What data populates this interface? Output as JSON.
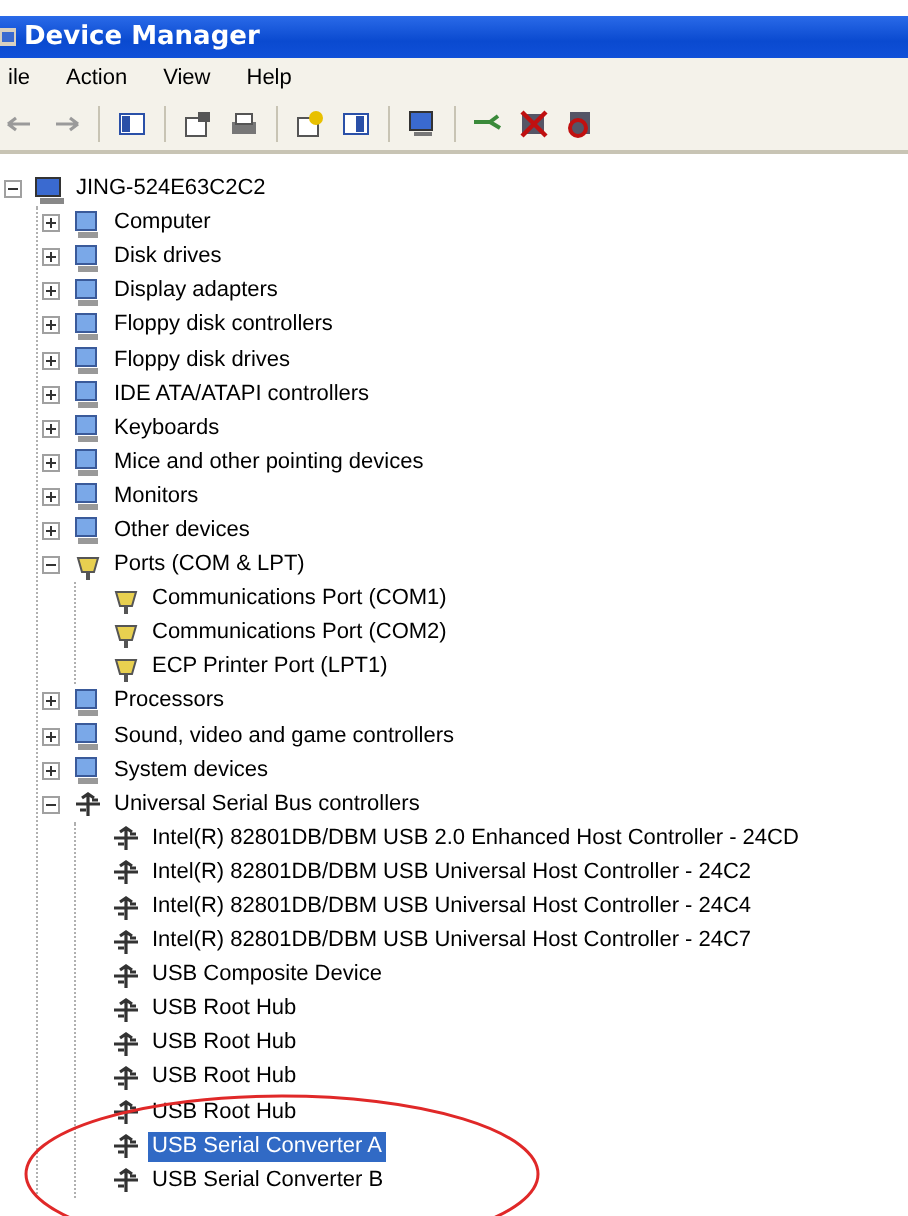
{
  "window": {
    "title": "Device Manager"
  },
  "menu": [
    {
      "label": "ile"
    },
    {
      "label": "Action"
    },
    {
      "label": "View"
    },
    {
      "label": "Help"
    }
  ],
  "tree": {
    "label": "JING-524E63C2C2",
    "kind": "computer",
    "expanded": true,
    "selected": false,
    "children": [
      {
        "label": "Computer",
        "kind": "device",
        "expanded": false,
        "selected": false
      },
      {
        "label": "Disk drives",
        "kind": "device",
        "expanded": false,
        "selected": false
      },
      {
        "label": "Display adapters",
        "kind": "device",
        "expanded": false,
        "selected": false
      },
      {
        "label": "Floppy disk controllers",
        "kind": "device",
        "expanded": false,
        "selected": false
      },
      {
        "label": "Floppy disk drives",
        "kind": "device",
        "expanded": false,
        "selected": false
      },
      {
        "label": "IDE ATA/ATAPI controllers",
        "kind": "device",
        "expanded": false,
        "selected": false
      },
      {
        "label": "Keyboards",
        "kind": "device",
        "expanded": false,
        "selected": false
      },
      {
        "label": "Mice and other pointing devices",
        "kind": "device",
        "expanded": false,
        "selected": false
      },
      {
        "label": "Monitors",
        "kind": "device",
        "expanded": false,
        "selected": false
      },
      {
        "label": "Other devices",
        "kind": "device",
        "expanded": false,
        "selected": false
      },
      {
        "label": "Ports (COM & LPT)",
        "kind": "port",
        "expanded": true,
        "selected": false,
        "children": [
          {
            "label": "Communications Port (COM1)",
            "kind": "port",
            "selected": false
          },
          {
            "label": "Communications Port (COM2)",
            "kind": "port",
            "selected": false
          },
          {
            "label": "ECP Printer Port (LPT1)",
            "kind": "port",
            "selected": false
          }
        ]
      },
      {
        "label": "Processors",
        "kind": "device",
        "expanded": false,
        "selected": false
      },
      {
        "label": "Sound, video and game controllers",
        "kind": "device",
        "expanded": false,
        "selected": false
      },
      {
        "label": "System devices",
        "kind": "device",
        "expanded": false,
        "selected": false
      },
      {
        "label": "Universal Serial Bus controllers",
        "kind": "usb",
        "expanded": true,
        "selected": false,
        "children": [
          {
            "label": "Intel(R) 82801DB/DBM USB 2.0 Enhanced Host Controller - 24CD",
            "kind": "usb",
            "selected": false
          },
          {
            "label": "Intel(R) 82801DB/DBM USB Universal Host Controller - 24C2",
            "kind": "usb",
            "selected": false
          },
          {
            "label": "Intel(R) 82801DB/DBM USB Universal Host Controller - 24C4",
            "kind": "usb",
            "selected": false
          },
          {
            "label": "Intel(R) 82801DB/DBM USB Universal Host Controller - 24C7",
            "kind": "usb",
            "selected": false
          },
          {
            "label": "USB Composite Device",
            "kind": "usb",
            "selected": false
          },
          {
            "label": "USB Root Hub",
            "kind": "usb",
            "selected": false
          },
          {
            "label": "USB Root Hub",
            "kind": "usb",
            "selected": false
          },
          {
            "label": "USB Root Hub",
            "kind": "usb",
            "selected": false
          },
          {
            "label": "USB Root Hub",
            "kind": "usb",
            "selected": false
          },
          {
            "label": "USB Serial Converter A",
            "kind": "usb",
            "selected": true
          },
          {
            "label": "USB Serial Converter B",
            "kind": "usb",
            "selected": false
          }
        ]
      }
    ]
  }
}
